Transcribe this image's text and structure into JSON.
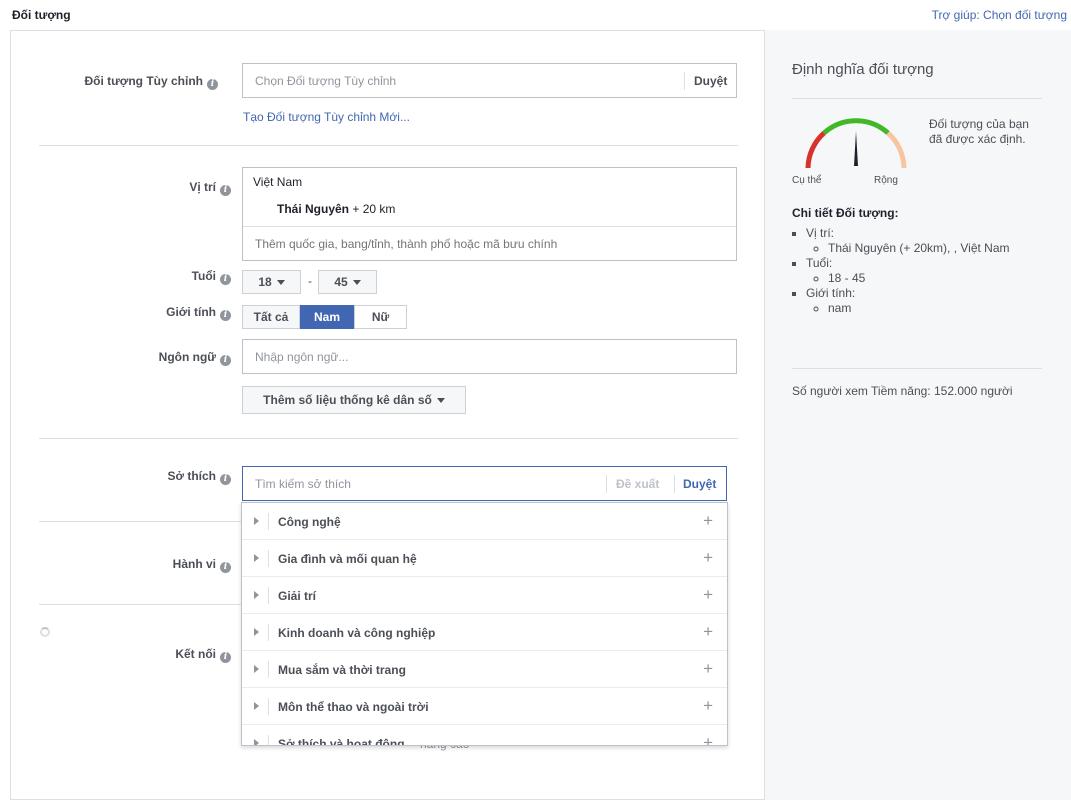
{
  "header": {
    "title": "Đối tượng",
    "help_link": "Trợ giúp: Chọn đối tượng"
  },
  "custom_audience": {
    "label": "Đối tượng Tùy chỉnh",
    "placeholder": "Chọn Đối tượng Tùy chỉnh",
    "browse": "Duyệt",
    "create_link": "Tạo Đối tượng Tùy chỉnh Mới..."
  },
  "location": {
    "label": "Vị trí",
    "country": "Việt Nam",
    "city": "Thái Nguyên",
    "radius": "+ 20 km",
    "placeholder": "Thêm quốc gia, bang/tỉnh, thành phố hoặc mã bưu chính"
  },
  "age": {
    "label": "Tuổi",
    "min": "18",
    "dash": "-",
    "max": "45"
  },
  "gender": {
    "label": "Giới tính",
    "options": [
      "Tất cả",
      "Nam",
      "Nữ"
    ],
    "selected": "Nam"
  },
  "language": {
    "label": "Ngôn ngữ",
    "placeholder": "Nhập ngôn ngữ..."
  },
  "demographics_button": "Thêm số liệu thống kê dân số",
  "interests": {
    "label": "Sở thích",
    "placeholder": "Tìm kiếm sở thích",
    "suggest": "Đề xuất",
    "browse": "Duyệt",
    "categories": [
      "Công nghệ",
      "Gia đình và mối quan hệ",
      "Giải trí",
      "Kinh doanh và công nghiệp",
      "Mua sắm và thời trang",
      "Môn thể thao và ngoài trời",
      "Sở thích và hoạt động"
    ],
    "hidden_text": "nâng cao"
  },
  "behaviors": {
    "label": "Hành vi"
  },
  "connections": {
    "label": "Kết nối"
  },
  "audience_definition": {
    "title": "Định nghĩa đối tượng",
    "gauge_desc": "Đối tượng của bạn đã được xác định.",
    "gauge_left": "Cụ thể",
    "gauge_right": "Rộng",
    "details_title": "Chi tiết Đối tượng:",
    "location_label": "Vị trí:",
    "location_value": "Thái Nguyên (+ 20km), , Việt Nam",
    "age_label": "Tuổi:",
    "age_value": "18 - 45",
    "gender_label": "Giới tính:",
    "gender_value": "nam",
    "potential_reach": "Số người xem Tiềm năng: 152.000 người"
  },
  "colors": {
    "accent": "#4267b2",
    "gauge_red": "#d8322d",
    "gauge_green": "#42b72a",
    "gauge_orange": "#f7c59f"
  }
}
